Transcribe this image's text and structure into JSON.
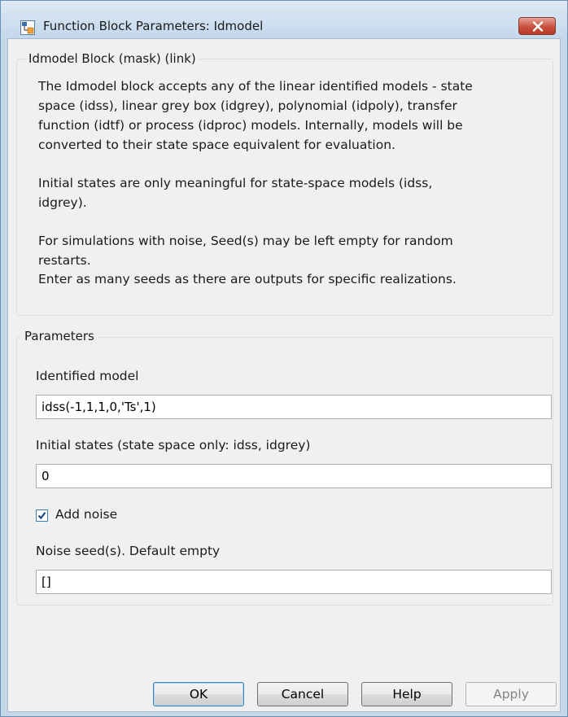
{
  "window": {
    "title": "Function Block Parameters: Idmodel"
  },
  "mask_group": {
    "legend": "Idmodel Block (mask) (link)",
    "description_lines": [
      "The Idmodel block accepts any of the linear identified models - state",
      "space (idss), linear grey box (idgrey), polynomial (idpoly), transfer",
      "function (idtf) or process (idproc) models. Internally, models will be",
      "converted to their state space equivalent for evaluation.",
      "Initial states are only meaningful for state-space models (idss,",
      "idgrey).",
      "For simulations  with noise, Seed(s) may be left empty for random",
      "restarts.",
      "Enter as many seeds as there are outputs for specific realizations."
    ]
  },
  "parameters": {
    "legend": "Parameters",
    "identified_model_label": "Identified model",
    "identified_model_value": "idss(-1,1,1,0,'Ts',1)",
    "initial_states_label": "Initial states (state space only: idss, idgrey)",
    "initial_states_value": "0",
    "add_noise_label": "Add noise",
    "add_noise_checked": true,
    "noise_seed_label": "Noise seed(s). Default empty",
    "noise_seed_value": "[]"
  },
  "buttons": {
    "ok": "OK",
    "cancel": "Cancel",
    "help": "Help",
    "apply": "Apply"
  },
  "icons": {
    "title_icon": "simulink-block-icon",
    "close_icon": "close-icon"
  },
  "colors": {
    "close_button": "#c9503e",
    "dialog_background": "#f0f0f0",
    "checkbox_accent": "#3c7fb1"
  }
}
